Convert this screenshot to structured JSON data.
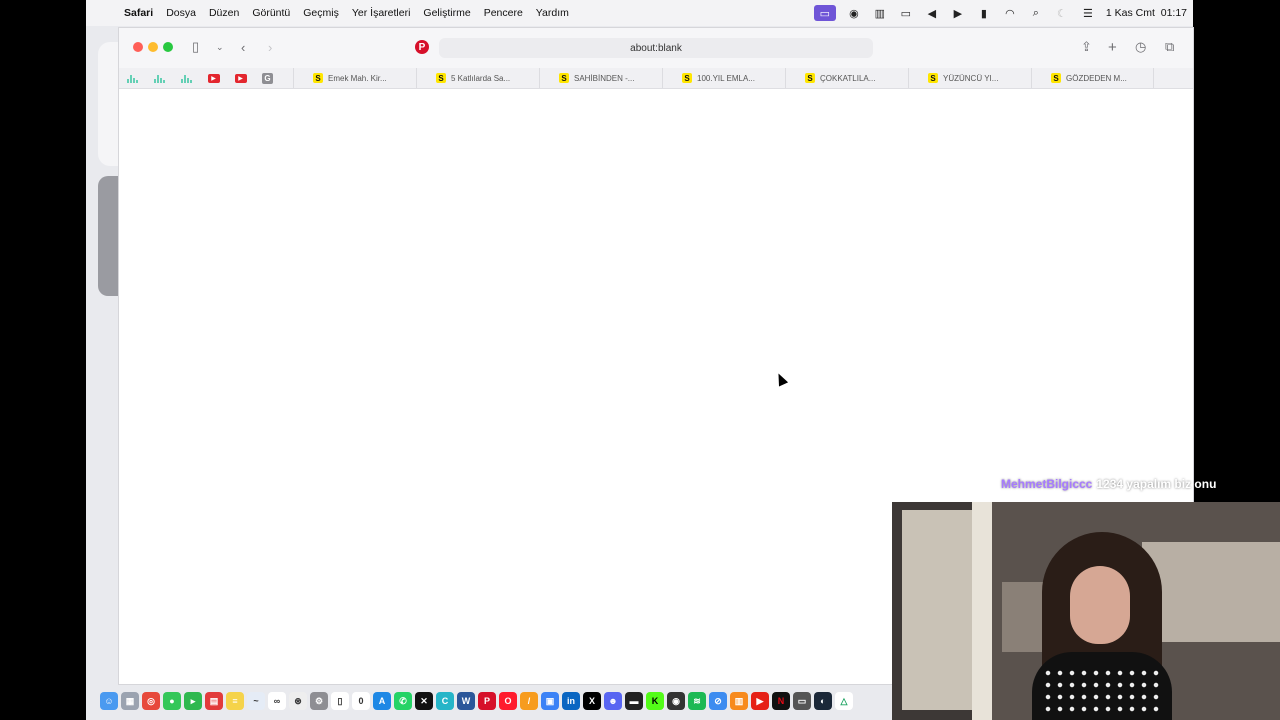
{
  "menubar": {
    "app_name": "Safari",
    "menus": [
      "Dosya",
      "Düzen",
      "Görüntü",
      "Geçmiş",
      "Yer İşaretleri",
      "Geliştirme",
      "Pencere",
      "Yardım"
    ],
    "date_time": "1 Kas Cmt  01:17",
    "status_icons": [
      "screen-mirroring-icon",
      "eye-icon",
      "bars-icon",
      "display-icon",
      "volume-icon",
      "play-icon",
      "battery-icon",
      "wifi-icon",
      "search-icon",
      "moon-icon",
      "control-center-icon"
    ]
  },
  "browser": {
    "address": "about:blank",
    "pinned_tabs": [
      "audio-bars-icon",
      "audio-bars-icon",
      "audio-bars-icon",
      "youtube-icon",
      "youtube-icon",
      "g-icon"
    ],
    "tabs": [
      {
        "title": "Emek Mah. Kir...",
        "favicon": "S"
      },
      {
        "title": "5 Katlılarda Sa...",
        "favicon": "S"
      },
      {
        "title": "SAHİBİNDEN -...",
        "favicon": "S"
      },
      {
        "title": "100.YIL EMLA...",
        "favicon": "S"
      },
      {
        "title": "ÇOKKATLILA...",
        "favicon": "S"
      },
      {
        "title": "YÜZÜNCÜ YI...",
        "favicon": "S"
      },
      {
        "title": "GÖZDEDEN M...",
        "favicon": "S"
      }
    ]
  },
  "chat": {
    "username": "MehmetBilgiccc",
    "message": "1234 yapalım biz onu"
  },
  "dock_apps": [
    "finder",
    "launchpad",
    "chrome",
    "messages",
    "facetime",
    "reminders",
    "notes",
    "freeform",
    "chatgpt",
    "safari",
    "settings",
    "calculator",
    "app-store",
    "whatsapp",
    "capcut",
    "canva",
    "word",
    "pinterest",
    "opera",
    "pages",
    "finder2",
    "linkedin",
    "x",
    "discord",
    "terminal",
    "kick",
    "obs",
    "spotify",
    "safari2",
    "books",
    "youtube",
    "netflix",
    "monitor",
    "steam",
    "drive"
  ]
}
